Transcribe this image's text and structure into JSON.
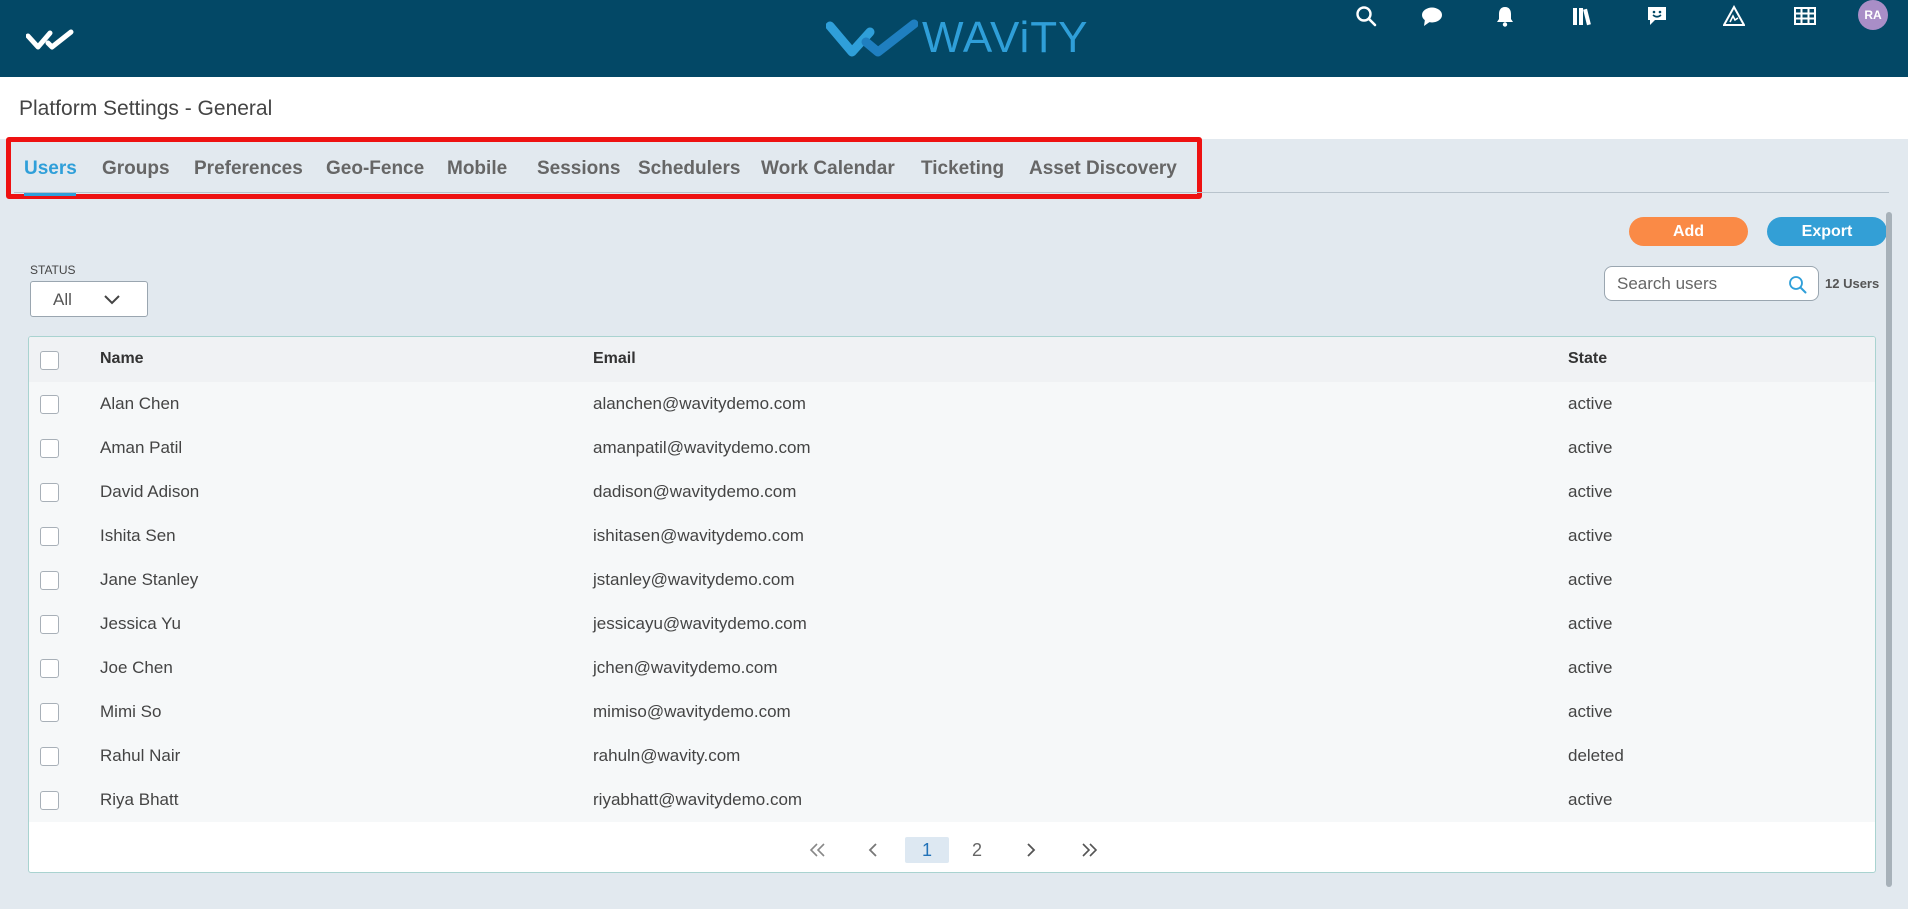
{
  "header": {
    "brand_name": "WAViTY",
    "menu_icon": "double-check-icon",
    "icons": [
      "search-icon",
      "chat-icon",
      "bell-icon",
      "library-icon",
      "feedback-icon",
      "alert-triangle-icon",
      "grid-icon"
    ],
    "avatar_initials": "RA",
    "bg_color": "#034866",
    "accent_color": "#2f9fd9"
  },
  "page": {
    "title": "Platform Settings - General"
  },
  "tabs": [
    {
      "label": "Users",
      "active": true
    },
    {
      "label": "Groups"
    },
    {
      "label": "Preferences"
    },
    {
      "label": "Geo-Fence"
    },
    {
      "label": "Mobile"
    },
    {
      "label": "Sessions"
    },
    {
      "label": "Schedulers"
    },
    {
      "label": "Work Calendar"
    },
    {
      "label": "Ticketing"
    },
    {
      "label": "Asset Discovery"
    }
  ],
  "toolbar": {
    "add_label": "Add",
    "export_label": "Export",
    "add_color": "#fa8a46",
    "export_color": "#339fd6"
  },
  "filters": {
    "status_label": "STATUS",
    "status_value": "All"
  },
  "search": {
    "placeholder": "Search users",
    "count_label": "12 Users"
  },
  "table": {
    "columns": [
      "Name",
      "Email",
      "State"
    ],
    "rows": [
      {
        "name": "Alan Chen",
        "email": "alanchen@wavitydemo.com",
        "state": "active"
      },
      {
        "name": "Aman Patil",
        "email": "amanpatil@wavitydemo.com",
        "state": "active"
      },
      {
        "name": "David Adison",
        "email": "dadison@wavitydemo.com",
        "state": "active"
      },
      {
        "name": "Ishita Sen",
        "email": "ishitasen@wavitydemo.com",
        "state": "active"
      },
      {
        "name": "Jane Stanley",
        "email": "jstanley@wavitydemo.com",
        "state": "active"
      },
      {
        "name": "Jessica Yu",
        "email": "jessicayu@wavitydemo.com",
        "state": "active"
      },
      {
        "name": "Joe Chen",
        "email": "jchen@wavitydemo.com",
        "state": "active"
      },
      {
        "name": "Mimi So",
        "email": "mimiso@wavitydemo.com",
        "state": "active"
      },
      {
        "name": "Rahul Nair",
        "email": "rahuln@wavity.com",
        "state": "deleted"
      },
      {
        "name": "Riya Bhatt",
        "email": "riyabhatt@wavitydemo.com",
        "state": "active"
      }
    ]
  },
  "pagination": {
    "pages": [
      "1",
      "2"
    ],
    "current": "1",
    "icons": [
      "first-page-icon",
      "prev-page-icon",
      "next-page-icon",
      "last-page-icon"
    ]
  }
}
